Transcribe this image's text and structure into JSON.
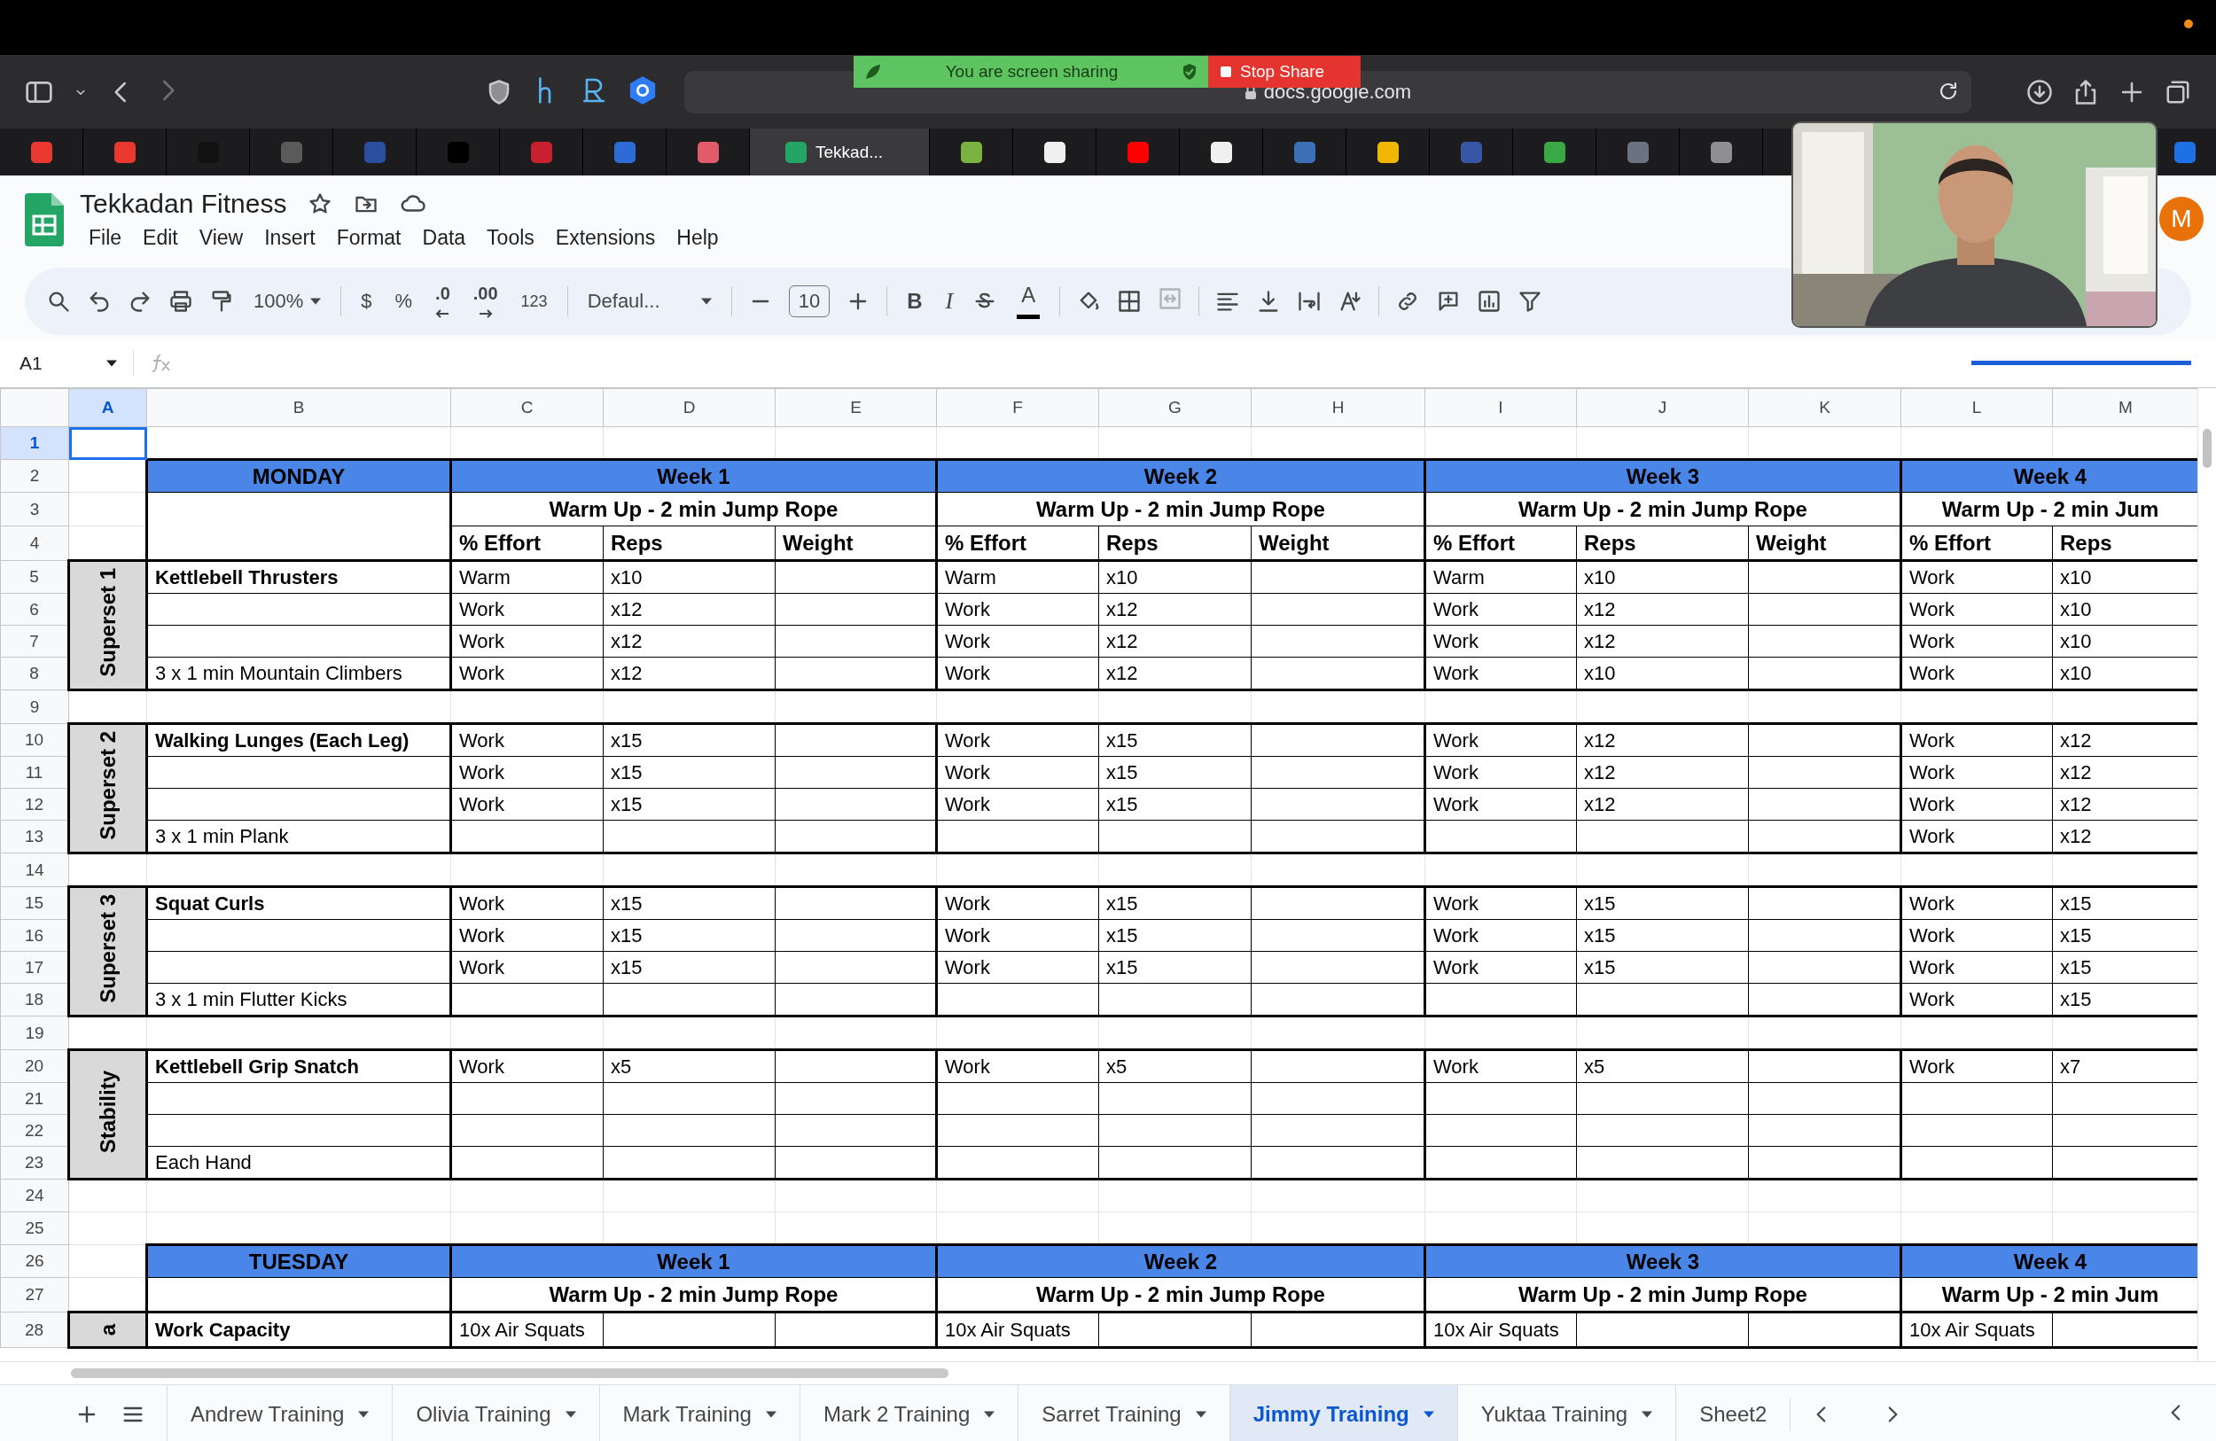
{
  "browser": {
    "address": "docs.google.com",
    "share_banner": {
      "message": "You are screen sharing",
      "stop_label": "Stop Share"
    },
    "tabs": [
      {
        "kind": "favicon",
        "color": "#e8382f",
        "selected": false
      },
      {
        "kind": "favicon",
        "color": "#e8382f",
        "selected": false
      },
      {
        "kind": "favicon",
        "color": "#111111",
        "selected": false
      },
      {
        "kind": "favicon",
        "color": "#5a5a5a",
        "selected": false
      },
      {
        "kind": "favicon",
        "color": "#2b4f9e",
        "selected": false
      },
      {
        "kind": "favicon",
        "color": "#000000",
        "selected": false
      },
      {
        "kind": "favicon",
        "color": "#c8202f",
        "selected": false
      },
      {
        "kind": "favicon",
        "color": "#2e6bd6",
        "selected": false
      },
      {
        "kind": "favicon",
        "color": "#e25b6a",
        "selected": false
      },
      {
        "kind": "page",
        "title": "Tekkad...",
        "color": "#23a566",
        "selected": true
      },
      {
        "kind": "favicon",
        "color": "#7bb342",
        "selected": false
      },
      {
        "kind": "favicon",
        "color": "#f0f0f0",
        "selected": false
      },
      {
        "kind": "favicon",
        "color": "#ff0000",
        "selected": false
      },
      {
        "kind": "favicon",
        "color": "#f0f0f0",
        "selected": false
      },
      {
        "kind": "favicon",
        "color": "#3b6fb6",
        "selected": false
      },
      {
        "kind": "favicon",
        "color": "#f2b705",
        "selected": false
      },
      {
        "kind": "favicon",
        "color": "#3956a6",
        "selected": false
      },
      {
        "kind": "favicon",
        "color": "#3aa845",
        "selected": false
      },
      {
        "kind": "favicon",
        "color": "#6b7280",
        "selected": false
      },
      {
        "kind": "favicon",
        "color": "#8e8e93",
        "selected": false
      },
      {
        "kind": "edge",
        "color": "#1f6fe5",
        "selected": false
      }
    ]
  },
  "document": {
    "title": "Tekkadan Fitness",
    "account_initial": "M",
    "menu": [
      "File",
      "Edit",
      "View",
      "Insert",
      "Format",
      "Data",
      "Tools",
      "Extensions",
      "Help"
    ],
    "toolbar": {
      "zoom": "100%",
      "currency": "$",
      "percent": "%",
      "decrease_decimals": ".0",
      "increase_decimals": ".00",
      "number_format": "123",
      "font": "Defaul...",
      "font_size": "10",
      "bold": "B",
      "italic": "I",
      "text_color": "A"
    },
    "name_box": "A1",
    "loading_bar": {
      "level": 1
    }
  },
  "sheet": {
    "columns": [
      {
        "label": "A",
        "selected": true
      },
      {
        "label": "B",
        "selected": false
      },
      {
        "label": "C",
        "selected": false
      },
      {
        "label": "D",
        "selected": false
      },
      {
        "label": "E",
        "selected": false
      },
      {
        "label": "F",
        "selected": false
      },
      {
        "label": "G",
        "selected": false
      },
      {
        "label": "H",
        "selected": false
      },
      {
        "label": "I",
        "selected": false
      },
      {
        "label": "J",
        "selected": false
      },
      {
        "label": "K",
        "selected": false
      },
      {
        "label": "L",
        "selected": false
      },
      {
        "label": "M",
        "selected": false
      }
    ],
    "row_numbers": [
      {
        "label": "1",
        "selected": true
      },
      {
        "label": "2",
        "selected": false
      },
      {
        "label": "3",
        "selected": false
      },
      {
        "label": "4",
        "selected": false
      },
      {
        "label": "5",
        "selected": false
      },
      {
        "label": "6",
        "selected": false
      },
      {
        "label": "7",
        "selected": false
      },
      {
        "label": "8",
        "selected": false
      },
      {
        "label": "9",
        "selected": false
      },
      {
        "label": "10",
        "selected": false
      },
      {
        "label": "11",
        "selected": false
      },
      {
        "label": "12",
        "selected": false
      },
      {
        "label": "13",
        "selected": false
      },
      {
        "label": "14",
        "selected": false
      },
      {
        "label": "15",
        "selected": false
      },
      {
        "label": "16",
        "selected": false
      },
      {
        "label": "17",
        "selected": false
      },
      {
        "label": "18",
        "selected": false
      },
      {
        "label": "19",
        "selected": false
      },
      {
        "label": "20",
        "selected": false
      },
      {
        "label": "21",
        "selected": false
      },
      {
        "label": "22",
        "selected": false
      },
      {
        "label": "23",
        "selected": false
      },
      {
        "label": "24",
        "selected": false
      },
      {
        "label": "25",
        "selected": false
      },
      {
        "label": "26",
        "selected": false
      },
      {
        "label": "27",
        "selected": false
      },
      {
        "label": "28",
        "selected": false
      }
    ],
    "days": [
      {
        "day": "MONDAY",
        "weeks": [
          "Week 1",
          "Week 2",
          "Week 3",
          "Week 4"
        ],
        "warmups": [
          "Warm Up - 2 min Jump Rope",
          "Warm Up - 2 min Jump Rope",
          "Warm Up - 2 min Jump Rope",
          "Warm Up - 2 min Jum"
        ],
        "metric_headers": [
          [
            "% Effort",
            "Reps",
            "Weight"
          ],
          [
            "% Effort",
            "Reps",
            "Weight"
          ],
          [
            "% Effort",
            "Reps",
            "Weight"
          ],
          [
            "% Effort",
            "Reps"
          ]
        ],
        "groups": [
          {
            "name": "Superset 1",
            "rows": [
              {
                "kind": "exercise",
                "text": "Kettlebell Thrusters",
                "sets": [
                  {
                    "effort": "Warm",
                    "reps": "x10"
                  },
                  {
                    "effort": "Warm",
                    "reps": "x10"
                  },
                  {
                    "effort": "Warm",
                    "reps": "x10"
                  },
                  {
                    "effort": "Work",
                    "reps": "x10"
                  }
                ]
              },
              {
                "kind": "blank",
                "sets": [
                  {
                    "effort": "Work",
                    "reps": "x12"
                  },
                  {
                    "effort": "Work",
                    "reps": "x12"
                  },
                  {
                    "effort": "Work",
                    "reps": "x12"
                  },
                  {
                    "effort": "Work",
                    "reps": "x10"
                  }
                ]
              },
              {
                "kind": "blank",
                "sets": [
                  {
                    "effort": "Work",
                    "reps": "x12"
                  },
                  {
                    "effort": "Work",
                    "reps": "x12"
                  },
                  {
                    "effort": "Work",
                    "reps": "x12"
                  },
                  {
                    "effort": "Work",
                    "reps": "x10"
                  }
                ]
              },
              {
                "kind": "note",
                "text": "3 x 1 min Mountain Climbers",
                "sets": [
                  {
                    "effort": "Work",
                    "reps": "x12"
                  },
                  {
                    "effort": "Work",
                    "reps": "x12"
                  },
                  {
                    "effort": "Work",
                    "reps": "x10"
                  },
                  {
                    "effort": "Work",
                    "reps": "x10"
                  }
                ]
              }
            ]
          },
          {
            "name": "Superset 2",
            "rows": [
              {
                "kind": "exercise",
                "text": "Walking Lunges (Each Leg)",
                "sets": [
                  {
                    "effort": "Work",
                    "reps": "x15"
                  },
                  {
                    "effort": "Work",
                    "reps": "x15"
                  },
                  {
                    "effort": "Work",
                    "reps": "x12"
                  },
                  {
                    "effort": "Work",
                    "reps": "x12"
                  }
                ]
              },
              {
                "kind": "blank",
                "sets": [
                  {
                    "effort": "Work",
                    "reps": "x15"
                  },
                  {
                    "effort": "Work",
                    "reps": "x15"
                  },
                  {
                    "effort": "Work",
                    "reps": "x12"
                  },
                  {
                    "effort": "Work",
                    "reps": "x12"
                  }
                ]
              },
              {
                "kind": "blank",
                "sets": [
                  {
                    "effort": "Work",
                    "reps": "x15"
                  },
                  {
                    "effort": "Work",
                    "reps": "x15"
                  },
                  {
                    "effort": "Work",
                    "reps": "x12"
                  },
                  {
                    "effort": "Work",
                    "reps": "x12"
                  }
                ]
              },
              {
                "kind": "note",
                "text": "3 x 1 min Plank",
                "last_week": {
                  "effort": "Work",
                  "reps": "x12"
                }
              }
            ]
          },
          {
            "name": "Superset 3",
            "rows": [
              {
                "kind": "exercise",
                "text": "Squat Curls",
                "sets": [
                  {
                    "effort": "Work",
                    "reps": "x15"
                  },
                  {
                    "effort": "Work",
                    "reps": "x15"
                  },
                  {
                    "effort": "Work",
                    "reps": "x15"
                  },
                  {
                    "effort": "Work",
                    "reps": "x15"
                  }
                ]
              },
              {
                "kind": "blank",
                "sets": [
                  {
                    "effort": "Work",
                    "reps": "x15"
                  },
                  {
                    "effort": "Work",
                    "reps": "x15"
                  },
                  {
                    "effort": "Work",
                    "reps": "x15"
                  },
                  {
                    "effort": "Work",
                    "reps": "x15"
                  }
                ]
              },
              {
                "kind": "blank",
                "sets": [
                  {
                    "effort": "Work",
                    "reps": "x15"
                  },
                  {
                    "effort": "Work",
                    "reps": "x15"
                  },
                  {
                    "effort": "Work",
                    "reps": "x15"
                  },
                  {
                    "effort": "Work",
                    "reps": "x15"
                  }
                ]
              },
              {
                "kind": "note",
                "text": "3 x 1 min Flutter Kicks",
                "last_week": {
                  "effort": "Work",
                  "reps": "x15"
                }
              }
            ]
          },
          {
            "name": "Stability",
            "rows": [
              {
                "kind": "exercise",
                "text": "Kettlebell Grip Snatch",
                "sets": [
                  {
                    "effort": "Work",
                    "reps": "x5"
                  },
                  {
                    "effort": "Work",
                    "reps": "x5"
                  },
                  {
                    "effort": "Work",
                    "reps": "x5"
                  },
                  {
                    "effort": "Work",
                    "reps": "x7"
                  }
                ]
              },
              {
                "kind": "blank"
              },
              {
                "kind": "blank"
              },
              {
                "kind": "note",
                "text": "Each Hand"
              }
            ]
          }
        ]
      },
      {
        "day": "TUESDAY",
        "weeks": [
          "Week 1",
          "Week 2",
          "Week 3",
          "Week 4"
        ],
        "warmups": [
          "Warm Up - 2 min Jump Rope",
          "Warm Up - 2 min Jump Rope",
          "Warm Up - 2 min Jump Rope",
          "Warm Up - 2 min Jum"
        ],
        "groups": [
          {
            "name": "a",
            "rows": [
              {
                "kind": "exercise",
                "text": "Work Capacity",
                "sets": [
                  {
                    "effort": "10x Air Squats"
                  },
                  {
                    "effort": "10x Air Squats"
                  },
                  {
                    "effort": "10x Air Squats"
                  },
                  {
                    "effort": "10x Air Squats"
                  }
                ]
              }
            ]
          }
        ]
      }
    ]
  },
  "sheet_tabs": [
    {
      "label": "Andrew Training",
      "kind": "sheet",
      "selected": false
    },
    {
      "label": "Olivia Training",
      "kind": "sheet",
      "selected": false
    },
    {
      "label": "Mark Training",
      "kind": "sheet",
      "selected": false
    },
    {
      "label": "Mark 2 Training",
      "kind": "sheet",
      "selected": false
    },
    {
      "label": "Sarret Training",
      "kind": "sheet",
      "selected": false
    },
    {
      "label": "Jimmy Training",
      "kind": "sheet",
      "selected": true
    },
    {
      "label": "Yuktaa Training",
      "kind": "sheet",
      "selected": false
    },
    {
      "label": "Sheet2",
      "kind": "partial",
      "selected": false
    }
  ]
}
